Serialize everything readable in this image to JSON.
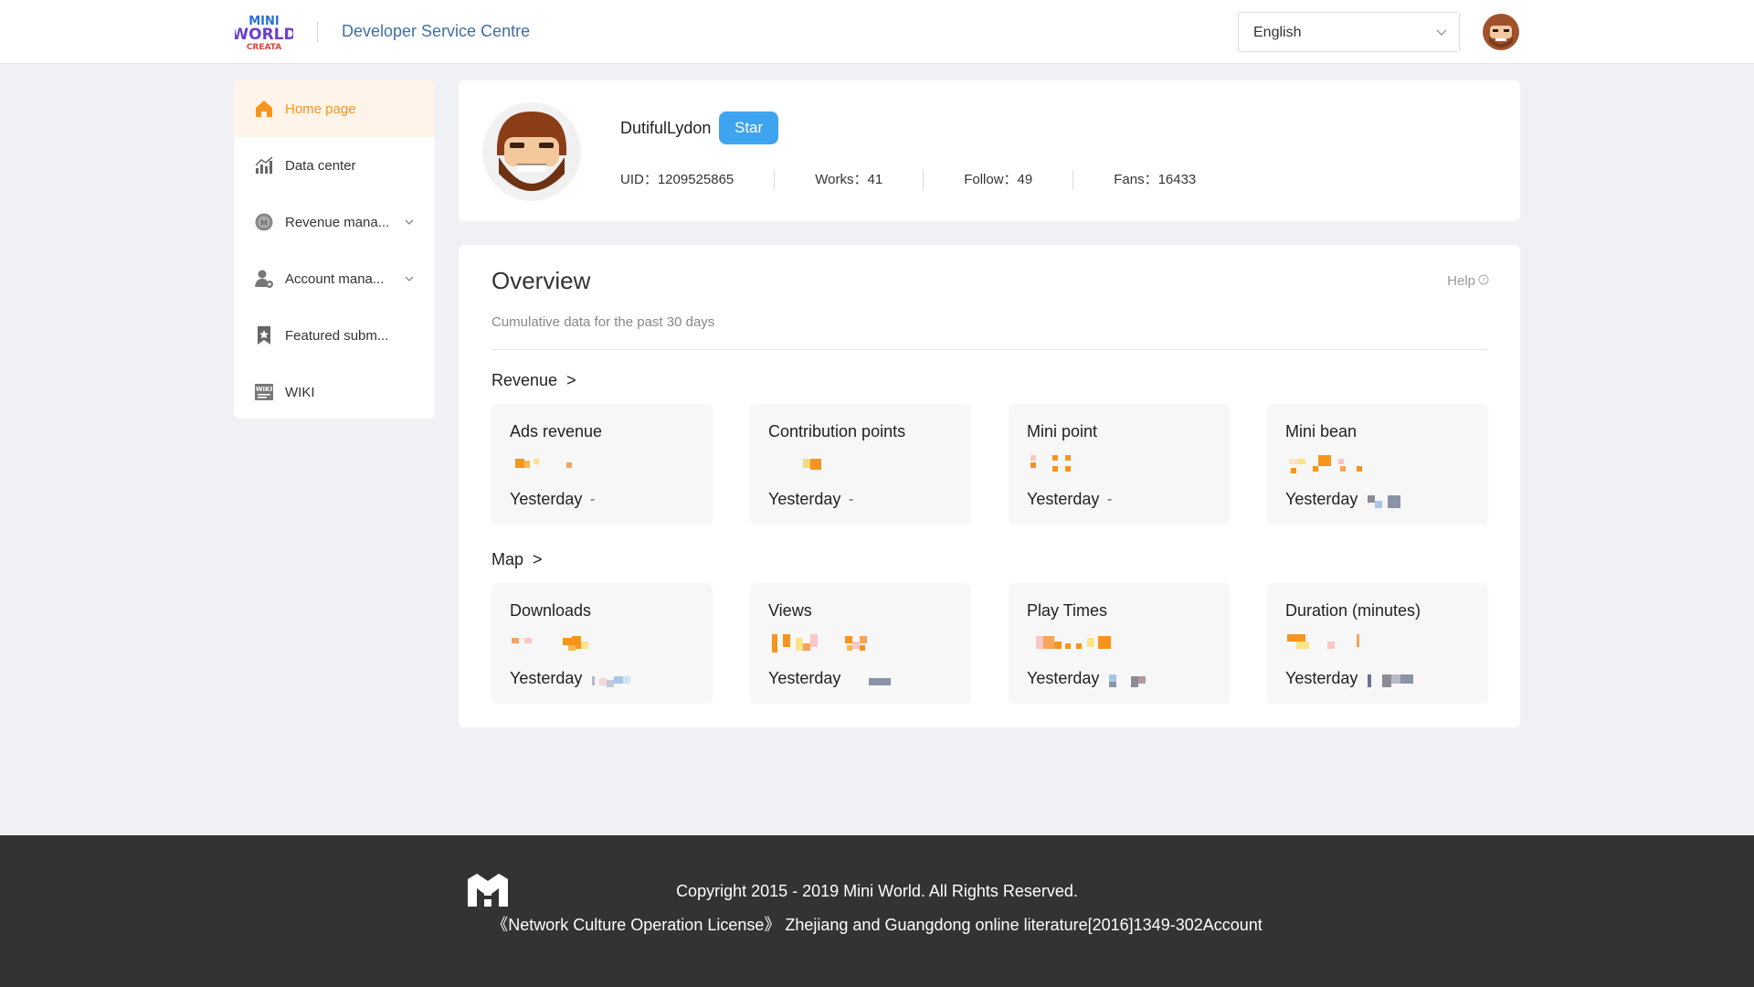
{
  "header": {
    "logo_text": "MINI WORLD CREATA",
    "title": "Developer Service Centre",
    "language": "English"
  },
  "sidebar": {
    "items": [
      {
        "label": "Home page",
        "icon": "home-icon",
        "active": true
      },
      {
        "label": "Data center",
        "icon": "bar-chart-icon"
      },
      {
        "label": "Revenue mana...",
        "icon": "coin-icon",
        "expandable": true
      },
      {
        "label": "Account mana...",
        "icon": "user-settings-icon",
        "expandable": true
      },
      {
        "label": "Featured subm...",
        "icon": "bookmark-star-icon"
      },
      {
        "label": "WIKI",
        "icon": "wiki-icon"
      }
    ]
  },
  "profile": {
    "name": "DutifulLydon",
    "badge": "Star",
    "uid": "UID：1209525865",
    "works": "Works：41",
    "follow": "Follow：49",
    "fans": "Fans：16433"
  },
  "overview": {
    "title": "Overview",
    "help": "Help",
    "subtitle": "Cumulative data for the past 30 days",
    "revenue_label": "Revenue",
    "map_label": "Map",
    "section_arrow": ">",
    "yesterday_label": "Yesterday",
    "revenue_cards": [
      {
        "title": "Ads revenue",
        "yesterday": "-"
      },
      {
        "title": "Contribution points",
        "yesterday": "-"
      },
      {
        "title": "Mini point",
        "yesterday": "-"
      },
      {
        "title": "Mini bean",
        "yesterday": ""
      }
    ],
    "map_cards": [
      {
        "title": "Downloads",
        "yesterday": ""
      },
      {
        "title": "Views",
        "yesterday": ""
      },
      {
        "title": "Play Times",
        "yesterday": ""
      },
      {
        "title": "Duration (minutes)",
        "yesterday": ""
      }
    ]
  },
  "footer": {
    "copyright": "Copyright 2015 - 2019 Mini World. All Rights Reserved.",
    "license": "《Network Culture Operation License》 Zhejiang and Guangdong online literature[2016]1349-302Account"
  },
  "colors": {
    "accent_orange": "#f7941d",
    "star_blue": "#3fa4ef",
    "title_blue": "#3f6fa6",
    "footer_bg": "#333333"
  }
}
